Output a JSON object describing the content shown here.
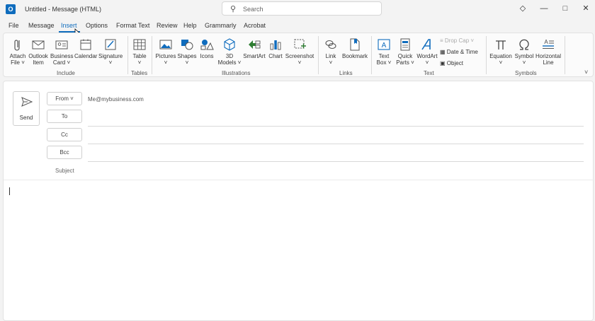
{
  "window": {
    "title": "Untitled  -  Message (HTML)",
    "app_icon_letter": "O"
  },
  "search": {
    "placeholder": "Search"
  },
  "titlebar_buttons": {
    "premium": "◇",
    "minimize": "—",
    "maximize": "□",
    "close": "✕"
  },
  "menu": {
    "tabs": [
      {
        "label": "File"
      },
      {
        "label": "Message"
      },
      {
        "label": "Insert",
        "active": true
      },
      {
        "label": "Options"
      },
      {
        "label": "Format Text"
      },
      {
        "label": "Review"
      },
      {
        "label": "Help"
      },
      {
        "label": "Grammarly"
      },
      {
        "label": "Acrobat"
      }
    ]
  },
  "ribbon": {
    "groups": {
      "include": "Include",
      "tables": "Tables",
      "illustrations": "Illustrations",
      "links": "Links",
      "text": "Text",
      "symbols": "Symbols"
    },
    "buttons": {
      "attach_file": [
        "Attach",
        "File ˅"
      ],
      "outlook_item": [
        "Outlook",
        "Item"
      ],
      "business_card": [
        "Business",
        "Card ˅"
      ],
      "calendar": [
        "Calendar"
      ],
      "signature": [
        "Signature",
        "˅"
      ],
      "table": [
        "Table",
        "˅"
      ],
      "pictures": [
        "Pictures",
        "˅"
      ],
      "shapes": [
        "Shapes",
        "˅"
      ],
      "icons": [
        "Icons"
      ],
      "models_3d": [
        "3D",
        "Models ˅"
      ],
      "smartart": [
        "SmartArt"
      ],
      "chart": [
        "Chart"
      ],
      "screenshot": [
        "Screenshot",
        "˅"
      ],
      "link": [
        "Link",
        "˅"
      ],
      "bookmark": [
        "Bookmark"
      ],
      "text_box": [
        "Text",
        "Box ˅"
      ],
      "quick_parts": [
        "Quick",
        "Parts ˅"
      ],
      "wordart": [
        "WordArt",
        "˅"
      ],
      "equation": [
        "Equation",
        "˅"
      ],
      "symbol": [
        "Symbol",
        "˅"
      ],
      "horizontal_line": [
        "Horizontal",
        "Line"
      ]
    },
    "small_buttons": {
      "drop_cap": "Drop Cap ˅",
      "date_time": "Date & Time",
      "object": "Object"
    },
    "collapse": "˅"
  },
  "compose": {
    "send_label": "Send",
    "from_label": "From ˅",
    "from_value": "Me@mybusiness.com",
    "to_label": "To",
    "cc_label": "Cc",
    "bcc_label": "Bcc",
    "subject_label": "Subject"
  }
}
